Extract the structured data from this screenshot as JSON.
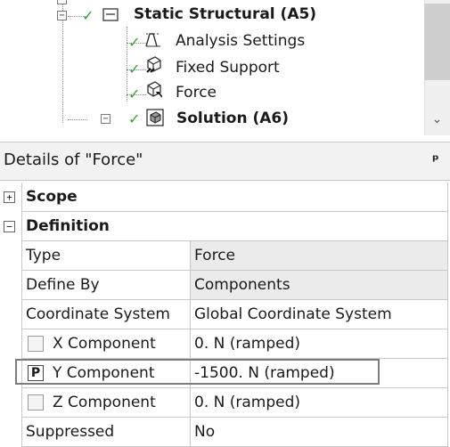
{
  "tree": {
    "nodes": [
      {
        "label": "Static Structural (A5)",
        "bold": true,
        "icon": "static-structural-icon",
        "expander": "−"
      },
      {
        "label": "Analysis Settings",
        "bold": false,
        "icon": "analysis-settings-icon"
      },
      {
        "label": "Fixed Support",
        "bold": false,
        "icon": "fixed-support-icon"
      },
      {
        "label": "Force",
        "bold": false,
        "icon": "force-icon"
      },
      {
        "label": "Solution (A6)",
        "bold": true,
        "icon": "solution-icon",
        "expander": "−"
      }
    ],
    "scroll_down_glyph": "⌄"
  },
  "details": {
    "title": "Details of \"Force\"",
    "pin": "ᵖ",
    "categories": {
      "scope": {
        "label": "Scope",
        "expander": "+"
      },
      "definition": {
        "label": "Definition",
        "expander": "−"
      }
    },
    "rows": {
      "type": {
        "name": "Type",
        "value": "Force"
      },
      "define_by": {
        "name": "Define By",
        "value": "Components"
      },
      "coord": {
        "name": "Coordinate System",
        "value": "Global Coordinate System"
      },
      "x": {
        "name": "X Component",
        "value": "0. N  (ramped)"
      },
      "y": {
        "name": "Y Component",
        "value": "-1500. N  (ramped)",
        "param": "P"
      },
      "z": {
        "name": "Z Component",
        "value": "0. N  (ramped)"
      },
      "suppressed": {
        "name": "Suppressed",
        "value": "No"
      }
    }
  },
  "colors": {
    "check": "#3a9a3a",
    "value_shaded": "#ebebeb",
    "header_bg": "#f2f2f2"
  }
}
